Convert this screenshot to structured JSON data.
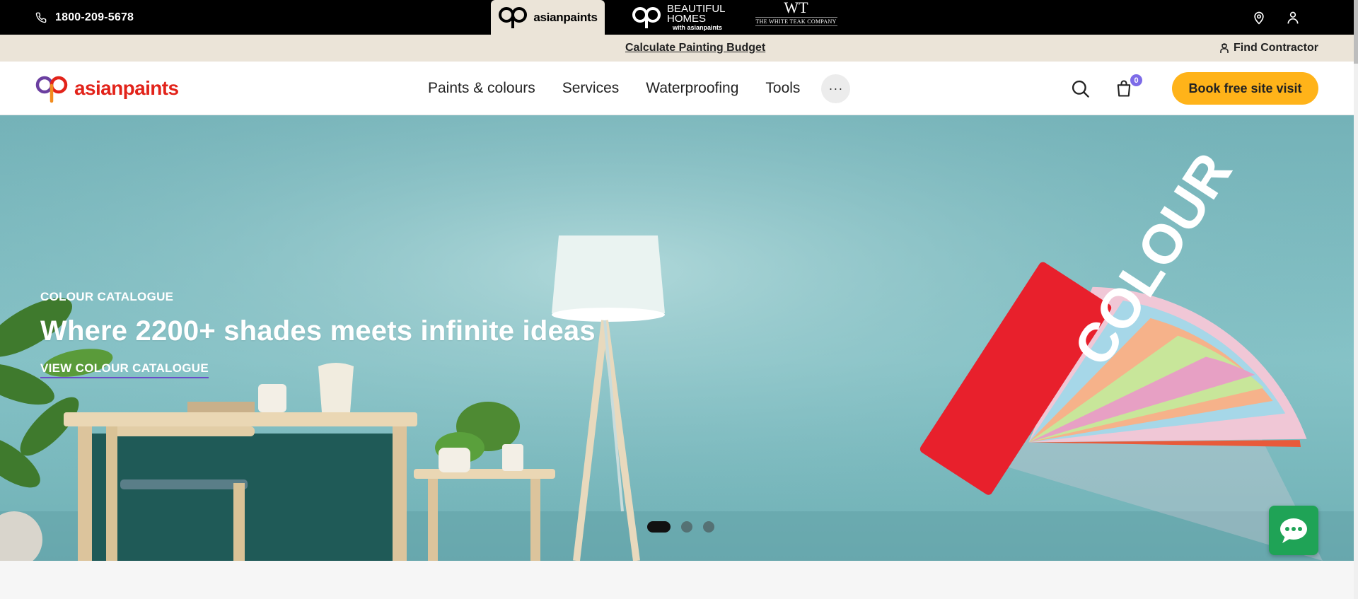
{
  "topbar": {
    "phone": "1800-209-5678",
    "brands": [
      {
        "name": "asianpaints"
      },
      {
        "name_line1": "BEAUTIFUL",
        "name_line2": "HOMES",
        "tag": "with asianpaints"
      },
      {
        "mark": "WT",
        "name": "THE WHITE TEAK COMPANY"
      }
    ]
  },
  "strip": {
    "budget_link": "Calculate Painting Budget",
    "find_contractor": "Find Contractor"
  },
  "nav": {
    "logo": "asianpaints",
    "items": [
      "Paints & colours",
      "Services",
      "Waterproofing",
      "Tools"
    ],
    "more": "···",
    "cart_count": "0",
    "cta": "Book free site visit"
  },
  "hero": {
    "eyebrow": "COLOUR CATALOGUE",
    "headline": "Where 2200+ shades meets infinite ideas",
    "link": "VIEW COLOUR CATALOGUE",
    "fan_label": "COLOUR",
    "slides": 3,
    "active_slide": 1
  },
  "colors": {
    "brand_red": "#e2231a",
    "cta_yellow": "#ffb319",
    "chat_green": "#1fa356",
    "strip_beige": "#ebe4d8",
    "badge_purple": "#7d6be8"
  }
}
